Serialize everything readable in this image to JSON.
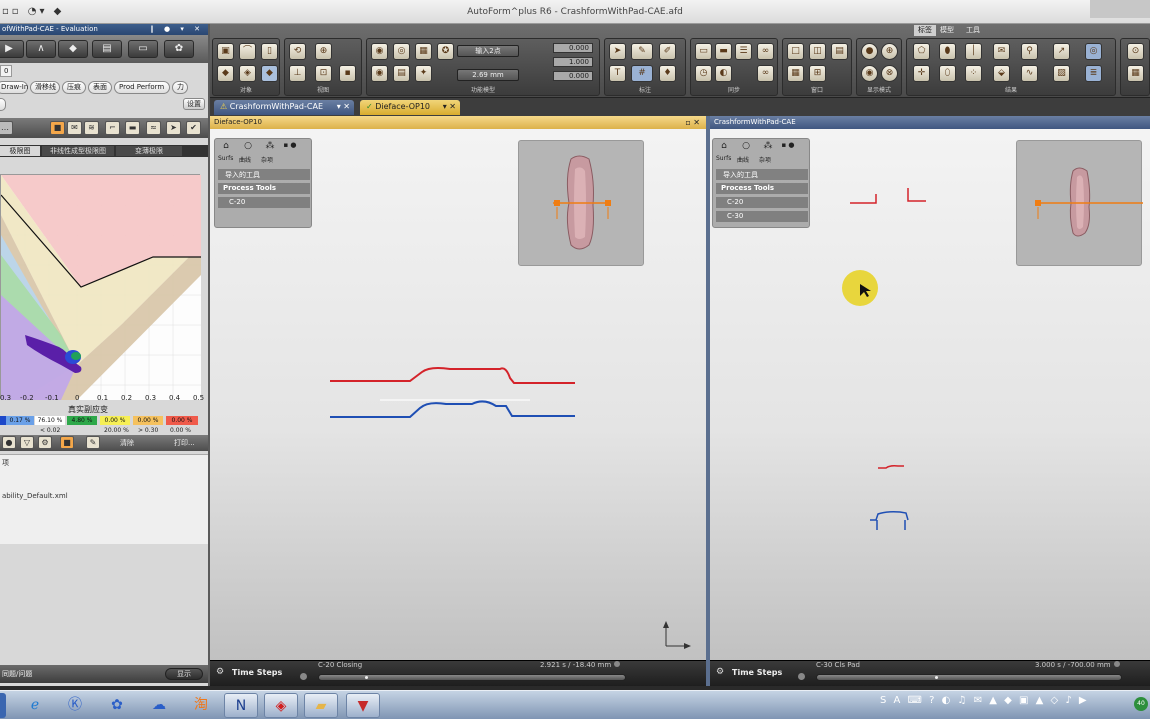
{
  "window": {
    "title": "AutoForm^plus R6 - CrashformWithPad-CAE.afd",
    "qat_icons": "▫▫ ◔▾ ◆"
  },
  "left_panel": {
    "header": "ofWithPad-CAE - Evaluation",
    "row1_tab": "0",
    "row2": [
      "Draw-In",
      "滑移线",
      "压痕",
      "表面",
      "Prod Perform",
      "力"
    ],
    "settings_label": "设置",
    "subtabs": [
      "极限图",
      "非线性成型极限图",
      "变薄极限"
    ],
    "axis_title": "真实副应变",
    "ticks": [
      "0.3",
      "-0.2",
      "-0.1",
      "0",
      "0.1",
      "0.2",
      "0.3",
      "0.4",
      "0.5"
    ],
    "colorbar": [
      {
        "value": "",
        "color": "#1d48c9"
      },
      {
        "value": "0.17 %",
        "color": "#6aa0e8"
      },
      {
        "value": "76.10 %",
        "color": "#ffffff"
      },
      {
        "value": "4.80 %",
        "color": "#2ea84a"
      },
      {
        "value": "0.00 %",
        "color": "#f6ef55"
      },
      {
        "value": "0.00 %",
        "color": "#f5c15e"
      },
      {
        "value": "0.00 %",
        "color": "#f05a4a"
      }
    ],
    "colorbar_labels": [
      "< 0.02",
      "20.00 %",
      "> 0.30",
      "0.00 %"
    ],
    "strip_labels": [
      "清除",
      "打印..."
    ],
    "list_items": [
      "项",
      "ability_Default.xml"
    ],
    "bottom_label": "同题/问题",
    "bottom_btn": "显示"
  },
  "ribbon": {
    "tabs": [
      "标签",
      "模型",
      "工具"
    ],
    "groups": [
      "对象",
      "视图",
      "功能模型",
      "标注",
      "同步",
      "窗口",
      "显示模式",
      "结果"
    ],
    "input1": "输入2点",
    "input2": "2.69 mm",
    "nums": [
      "0.000",
      "1.000",
      "0.000"
    ]
  },
  "doc_tabs": [
    {
      "label": "CrashformWithPad-CAE",
      "icon": "⚠"
    },
    {
      "label": "Dieface-OP10",
      "icon": "✓"
    }
  ],
  "viewport_left": {
    "title": "Dieface-OP10",
    "tree_icons": [
      "Surfs",
      "曲线",
      "杂项"
    ],
    "tree_items": [
      "导入的工具",
      "Process Tools",
      "C-20"
    ],
    "timesteps_label": "Time Steps",
    "step_name": "C-20 Closing",
    "step_value": "2.921 s / -18.40 mm"
  },
  "viewport_right": {
    "title": "CrashformWithPad-CAE",
    "tree_icons": [
      "Surfs",
      "曲线",
      "杂项"
    ],
    "tree_items": [
      "导入的工具",
      "Process Tools",
      "C-20",
      "C-30"
    ],
    "timesteps_label": "Time Steps",
    "step_name": "C-30 Cls Pad",
    "step_value": "3.000 s / -700.00 mm"
  },
  "colors": {
    "curve_upper": "#d4232a",
    "curve_lower": "#1f4fb4",
    "curve_white": "#f4f4f4",
    "orange": "#f07d12",
    "tooltip_dot": "#e8d42a"
  },
  "taskbar": {
    "apps": [
      "ie-icon",
      "k-icon",
      "share-icon",
      "cloud-icon",
      "taobao-icon",
      "autoform-icon",
      "pdf-icon",
      "folder-icon",
      "autoform2-icon"
    ],
    "tray_icons": "S A ⌨ ? ◐ ♫ ✉ ▲ ◆ ▣ ▲ ◇ ♪ ▶",
    "clock": "40"
  }
}
